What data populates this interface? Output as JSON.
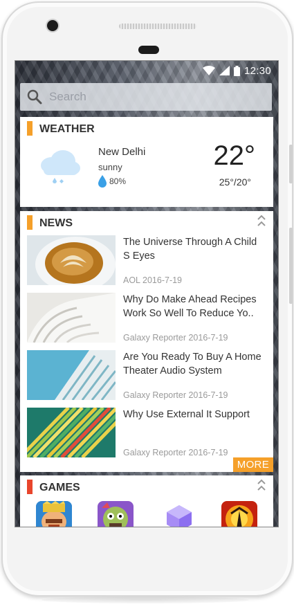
{
  "status": {
    "time": "12:30"
  },
  "search": {
    "placeholder": "Search"
  },
  "weather": {
    "title": "WEATHER",
    "city": "New Delhi",
    "condition": "sunny",
    "humidity": "80%",
    "temperature": "22°",
    "range": "25°/20°",
    "accent_color": "#f5a02a"
  },
  "news": {
    "title": "NEWS",
    "accent_color": "#f5a02a",
    "more_label": "MORE",
    "items": [
      {
        "headline": "The Universe Through A Child S Eyes",
        "meta": "AOL 2016-7-19",
        "thumb": "coffee-latte-art"
      },
      {
        "headline": "Why Do Make Ahead Recipes Work So Well To Reduce Yo..",
        "meta": "Galaxy Reporter 2016-7-19",
        "thumb": "white-architecture"
      },
      {
        "headline": "Are You Ready To Buy A Home Theater Audio System",
        "meta": "Galaxy Reporter 2016-7-19",
        "thumb": "building-balconies"
      },
      {
        "headline": "Why Use External It Support",
        "meta": "Galaxy Reporter 2016-7-19",
        "thumb": "colorful-ribs"
      }
    ]
  },
  "games": {
    "title": "GAMES",
    "accent_color": "#e8452c",
    "items": [
      "clash-royale-icon",
      "plants-vs-zombies-icon",
      "purple-cube-icon",
      "fire-game-icon"
    ]
  }
}
